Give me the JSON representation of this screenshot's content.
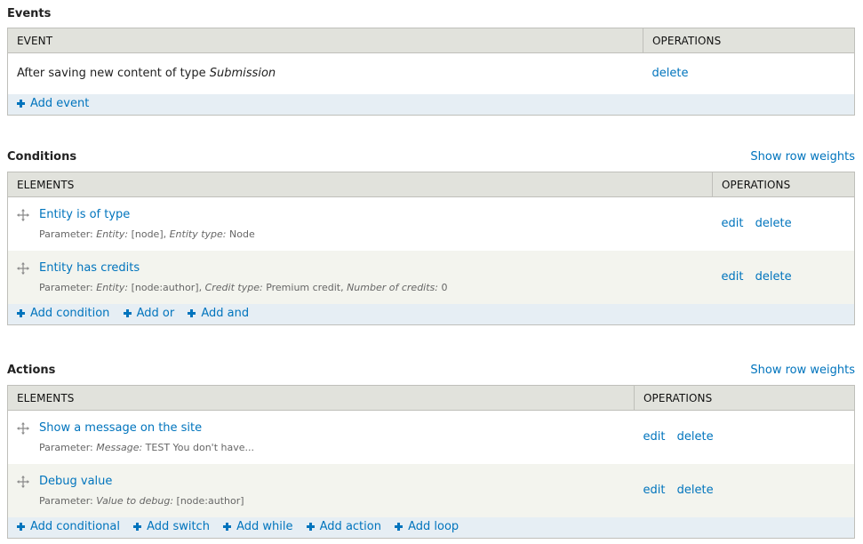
{
  "events": {
    "title": "Events",
    "columns": [
      "EVENT",
      "OPERATIONS"
    ],
    "rows": [
      {
        "text": "After saving new content of type ",
        "text_italic": "Submission",
        "operations": [
          "delete"
        ]
      }
    ],
    "footer_links": [
      "Add event"
    ]
  },
  "conditions": {
    "title": "Conditions",
    "row_weights_label": "Show row weights",
    "columns": [
      "ELEMENTS",
      "OPERATIONS"
    ],
    "rows": [
      {
        "title": "Entity is of type",
        "param_label": "Parameter:",
        "params": [
          {
            "name": "Entity:",
            "value": "[node],"
          },
          {
            "name": "Entity type:",
            "value": "Node"
          }
        ],
        "operations": [
          "edit",
          "delete"
        ]
      },
      {
        "title": "Entity has credits",
        "param_label": "Parameter:",
        "params": [
          {
            "name": "Entity:",
            "value": "[node:author],"
          },
          {
            "name": "Credit type:",
            "value": "Premium credit,"
          },
          {
            "name": "Number of credits:",
            "value": "0"
          }
        ],
        "operations": [
          "edit",
          "delete"
        ]
      }
    ],
    "footer_links": [
      "Add condition",
      "Add or",
      "Add and"
    ]
  },
  "actions": {
    "title": "Actions",
    "row_weights_label": "Show row weights",
    "columns": [
      "ELEMENTS",
      "OPERATIONS"
    ],
    "rows": [
      {
        "title": "Show a message on the site",
        "param_label": "Parameter:",
        "params": [
          {
            "name": "Message:",
            "value": "TEST You don't have..."
          }
        ],
        "operations": [
          "edit",
          "delete"
        ]
      },
      {
        "title": "Debug value",
        "param_label": "Parameter:",
        "params": [
          {
            "name": "Value to debug:",
            "value": "[node:author]"
          }
        ],
        "operations": [
          "edit",
          "delete"
        ]
      }
    ],
    "footer_links": [
      "Add conditional",
      "Add switch",
      "Add while",
      "Add action",
      "Add loop"
    ]
  },
  "icons": {
    "drag": "drag-handle-icon",
    "add": "plus-icon"
  },
  "colors": {
    "link": "#0074bd",
    "header_bg": "#e1e2dc",
    "even_row_bg": "#f3f4ee",
    "footer_bg": "#e6eef4",
    "border": "#bfbfba"
  }
}
